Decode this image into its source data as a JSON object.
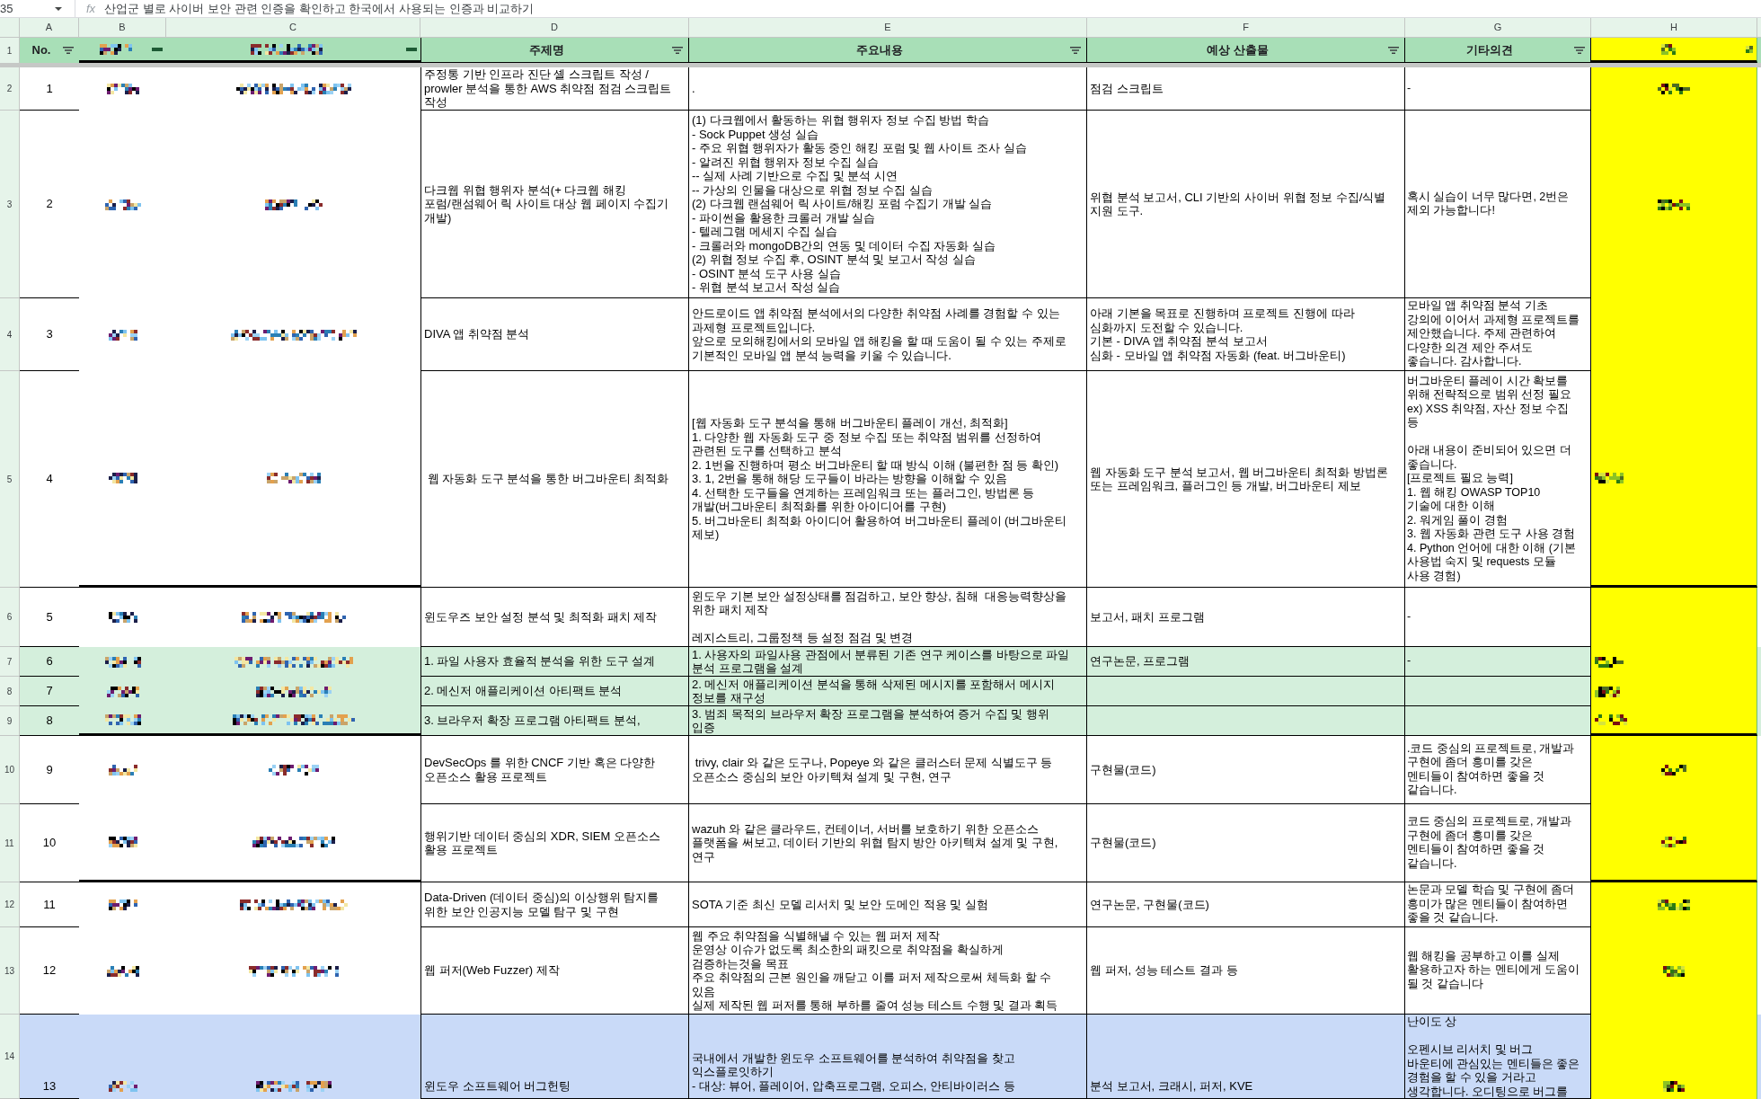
{
  "formula_bar": {
    "name_box": "35",
    "fx": "fx",
    "formula": "산업군 별로 사이버 보안 관련 인증을 확인하고 한국에서 사용되는 인증과 비교하기"
  },
  "columns": [
    {
      "letter": "A"
    },
    {
      "letter": "B"
    },
    {
      "letter": "C"
    },
    {
      "letter": "D"
    },
    {
      "letter": "E"
    },
    {
      "letter": "F"
    },
    {
      "letter": "G"
    },
    {
      "letter": "H",
      "color": "#ffff00"
    }
  ],
  "header": {
    "row_number": "1",
    "section_end": true,
    "cells": [
      {
        "kind": "text",
        "label": "No."
      },
      {
        "kind": "redacted"
      },
      {
        "kind": "redacted"
      },
      {
        "kind": "text",
        "label": "주제명"
      },
      {
        "kind": "text",
        "label": "주요내용"
      },
      {
        "kind": "text",
        "label": "예상 산출물"
      },
      {
        "kind": "text",
        "label": "기타의견"
      },
      {
        "kind": "redacted"
      }
    ]
  },
  "rows": [
    {
      "row_number": "2",
      "no": "1",
      "b": {
        "kind": "redacted"
      },
      "c": {
        "kind": "redacted"
      },
      "topic": "주정통 기반 인프라 진단 셸 스크립트 작성 /\nprowler 분석을 통한 AWS 취약점 점검 스크립트\n작성",
      "content": ".",
      "deliverable": "점검 스크립트",
      "comment": "-",
      "h": {
        "kind": "redacted"
      },
      "section_end": false
    },
    {
      "row_number": "3",
      "no": "2",
      "b": {
        "kind": "redacted"
      },
      "c": {
        "kind": "redacted"
      },
      "topic": "다크웹 위협 행위자 분석(+ 다크웹 해킹\n포럼/랜섬웨어 릭 사이트 대상 웹 페이지 수집기\n개발)",
      "content": "(1) 다크웹에서 활동하는 위협 행위자 정보 수집 방법 학습\n- Sock Puppet 생성 실습\n- 주요 위협 행위자가 활동 중인 해킹 포럼 및 웹 사이트 조사 실습\n- 알려진 위협 행위자 정보 수집 실습\n-- 실제 사례 기반으로 수집 및 분석 시연\n-- 가상의 인물을 대상으로 위협 정보 수집 실습\n(2) 다크웹 랜섬웨어 릭 사이트/해킹 포럼 수집기 개발 실습\n- 파이썬을 활용한 크롤러 개발 실습\n- 텔레그램 메세지 수집 실습\n- 크롤러와 mongoDB간의 연동 및 데이터 수집 자동화 실습\n(2) 위협 정보 수집 후, OSINT 분석 및 보고서 작성 실습\n- OSINT 분석 도구 사용 실습\n- 위협 분석 보고서 작성 실습",
      "deliverable": "위협 분석 보고서, CLI 기반의 사이버 위협 정보 수집/식별\n지원 도구.",
      "comment": "혹시 실습이 너무 많다면, 2번은\n제외 가능합니다!",
      "h": {
        "kind": "redacted"
      },
      "section_end": false
    },
    {
      "row_number": "4",
      "no": "3",
      "b": {
        "kind": "redacted"
      },
      "c": {
        "kind": "redacted"
      },
      "topic": "DIVA 앱 취약점 분석",
      "content": "안드로이드 앱 취약점 분석에서의 다양한 취약점 사례를 경험할 수 있는\n과제형 프로젝트입니다.\n앞으로 모의해킹에서의 모바일 앱 해킹을 할 때 도움이 될 수 있는 주제로\n기본적인 모바일 앱 분석 능력을 키울 수 있습니다.",
      "deliverable": "아래 기본을 목표로 진행하며 프로젝트 진행에 따라\n심화까지 도전할 수 있습니다.\n기본 - DIVA 앱 취약점 분석 보고서\n심화 - 모바일 앱 취약점 자동화 (feat. 버그바운티)",
      "comment": "모바일 앱 취약점 분석 기초\n강의에 이어서 과제형 프로젝트를\n제안했습니다. 주제 관련하여\n다양한 의견 제안 주셔도\n좋습니다. 감사합니다.",
      "section_end": false
    },
    {
      "row_number": "5",
      "no": "4",
      "b": {
        "kind": "redacted"
      },
      "c": {
        "kind": "redacted"
      },
      "topic": " 웹 자동화 도구 분석을 통한 버그바운티 최적화",
      "content": "[웹 자동화 도구 분석을 통해 버그바운티 플레이 개선, 최적화]\n1. 다양한 웹 자동화 도구 중 정보 수집 또는 취약점 범위를 선정하여\n관련된 도구를 선택하고 분석\n2. 1번을 진행하며 평소 버그바운티 할 때 방식 이해 (불편한 점 등 확인)\n3. 1, 2번을 통해 해당 도구들이 바라는 방향을 이해할 수 있음\n4. 선택한 도구들을 연계하는 프레임워크 또는 플러그인, 방법론 등\n개발(버그바운티 최적화를 위한 아이디어를 구현)\n5. 버그바운티 최적화 아이디어 활용하여 버그바운티 플레이 (버그바운티\n제보)",
      "deliverable": "웹 자동화 도구 분석 보고서, 웹 버그바운티 최적화 방법론\n또는 프레임워크, 플러그인 등 개발, 버그바운티 제보",
      "comment": "버그바운티 플레이 시간 확보를\n위해 전략적으로 범위 선정 필요\nex) XSS 취약점, 자산 정보 수집\n등\n\n아래 내용이 준비되어 있으면 더\n좋습니다.\n[프로젝트 필요 능력]\n1. 웹 해킹 OWASP TOP10\n기술에 대한 이해\n2. 워게임 풀이 경험\n3. 웹 자동화 관련 도구 사용 경험\n4. Python 언어에 대한 이해 (기본\n사용법 숙지 및 requests 모듈\n사용 경험)",
      "h": {
        "kind": "redacted"
      },
      "section_end": true
    },
    {
      "row_number": "6",
      "no": "5",
      "b": {
        "kind": "redacted"
      },
      "c": {
        "kind": "redacted"
      },
      "topic": "윈도우즈 보안 설정 분석 및 최적화 패치 제작",
      "content": "윈도우 기본 보안 설정상태를 점검하고, 보안 향상, 침해  대응능력향상을\n위한 패치 제작\n\n레지스트리, 그룹정책 등 설정 점검 및 변경",
      "deliverable": "보고서, 패치 프로그램",
      "comment": "-",
      "section_end": false
    },
    {
      "row_number": "7",
      "no": "6",
      "color": "#d4efdc",
      "b": {
        "kind": "redacted"
      },
      "c": {
        "kind": "redacted"
      },
      "topic": "1. 파일 사용자 효율적 분석을 위한 도구 설계",
      "content": "1. 사용자의 파일사용 관점에서 분류된 기존 연구 케이스를 바탕으로 파일\n분석 프로그램을 설계",
      "deliverable": "연구논문, 프로그램",
      "comment": "-",
      "h": {
        "kind": "redacted"
      },
      "section_end": false
    },
    {
      "row_number": "8",
      "no": "7",
      "color": "#d4efdc",
      "b": {
        "kind": "redacted"
      },
      "c": {
        "kind": "redacted"
      },
      "topic": "2. 메신저 애플리케이션 아티팩트 분석",
      "content": "2. 메신저 애플리케이션 분석을 통해 삭제된 메시지를 포함해서 메시지\n정보를 재구성",
      "h": {
        "kind": "redacted"
      },
      "section_end": false
    },
    {
      "row_number": "9",
      "no": "8",
      "color": "#d4efdc",
      "b": {
        "kind": "redacted"
      },
      "c": {
        "kind": "redacted"
      },
      "topic": "3. 브라우저 확장 프로그램 아티팩트 분석,",
      "content": "3. 범죄 목적의 브라우저 확장 프로그램을 분석하여 증거 수집 및 행위\n입증",
      "h": {
        "kind": "redacted"
      },
      "section_end": true
    },
    {
      "row_number": "10",
      "no": "9",
      "b": {
        "kind": "redacted"
      },
      "c": {
        "kind": "redacted"
      },
      "topic": "DevSecOps 를 위한 CNCF 기반 혹은 다양한\n오픈소스 활용 프로젝트",
      "content": " trivy, clair 와 같은 도구나, Popeye 와 같은 클러스터 문제 식별도구 등\n오픈소스 중심의 보안 아키텍쳐 설계 및 구현, 연구",
      "deliverable": "구현물(코드)",
      "comment": ".코드 중심의 프로젝트로, 개발과\n구현에 좀더 흥미를 갖은\n멘티들이 참여하면 좋을 것\n같습니다.",
      "h": {
        "kind": "redacted"
      },
      "section_end": false
    },
    {
      "row_number": "11",
      "no": "10",
      "b": {
        "kind": "redacted"
      },
      "c": {
        "kind": "redacted"
      },
      "topic": "행위기반 데이터 중심의 XDR, SIEM 오픈소스\n활용 프로젝트",
      "content": "wazuh 와 같은 클라우드, 컨테이너, 서버를 보호하기 위한 오픈소스\n플랫폼을 써보고, 데이터 기반의 위협 탐지 방안 아키텍쳐 설계 및 구현,\n연구",
      "deliverable": "구현물(코드)",
      "comment": "코드 중심의 프로젝트로, 개발과\n구현에 좀더 흥미를 갖은\n멘티들이 참여하면 좋을 것\n같습니다.",
      "h": {
        "kind": "redacted"
      },
      "section_end": true
    },
    {
      "row_number": "12",
      "no": "11",
      "b": {
        "kind": "redacted"
      },
      "c": {
        "kind": "redacted"
      },
      "topic": "Data-Driven (데이터 중심)의 이상행위 탐지를\n위한 보안 인공지능 모델 탐구 및 구현",
      "content": "SOTA 기준 최신 모델 리서치 및 보안 도메인 적용 및 실험",
      "deliverable": "연구논문, 구현물(코드)",
      "comment": "논문과 모델 학습 및 구현에 좀더\n흥미가 많은 멘티들이 참여하면\n좋을 것 같습니다.",
      "h": {
        "kind": "redacted"
      },
      "section_end": false
    },
    {
      "row_number": "13",
      "no": "12",
      "b": {
        "kind": "redacted"
      },
      "c": {
        "kind": "redacted"
      },
      "topic": "웹 퍼저(Web Fuzzer) 제작",
      "content": "웹 주요 취약점을 식별해낼 수 있는 웹 퍼저 제작\n운영상 이슈가 없도록 최소한의 패킷으로 취약점을 확실하게\n검증하는것을 목표\n주요 취약점의 근본 원인을 깨닫고 이를 퍼저 제작으로써 체득화 할 수\n있음\n실제 제작된 웹 퍼저를 통해 부하를 줄여 성능 테스트 수행 및 결과 획득",
      "deliverable": "웹 퍼저, 성능 테스트 결과 등",
      "comment": "웹 해킹을 공부하고 이를 실제\n활용하고자 하는 멘티에게 도움이\n될 것 같습니다",
      "h": {
        "kind": "redacted"
      },
      "section_end": false
    },
    {
      "row_number": "14",
      "no": "13",
      "color": "#c9daf8",
      "b": {
        "kind": "redacted"
      },
      "c": {
        "kind": "redacted"
      },
      "topic": "윈도우 소프트웨어 버그헌팅",
      "content": "국내에서 개발한 윈도우 소프트웨어를 분석하여 취약점을 찾고\n익스플로잇하기\n- 대상: 뷰어, 플레이어, 압축프로그램, 오피스, 안티바이러스 등",
      "deliverable": "분석 보고서, 크래시, 퍼저, KVE",
      "comment": "난이도 상\n\n오펜시브 리서치 및 버그\n바운티에 관심있는 멘티들은 좋은\n경험을 할 수 있을 거라고\n생각합니다. 오디팅으로 버그를",
      "h": {
        "kind": "redacted"
      },
      "section_end": false
    }
  ]
}
